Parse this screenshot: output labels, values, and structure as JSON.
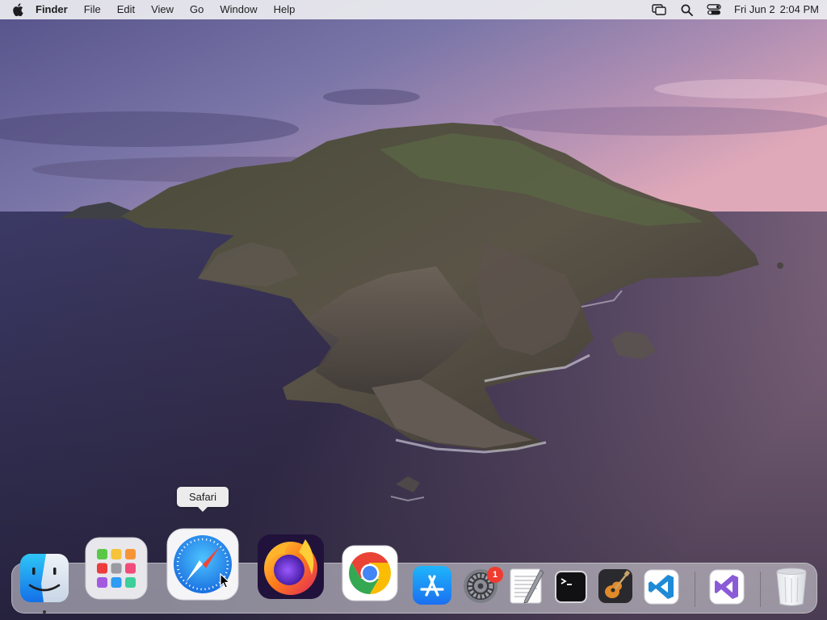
{
  "menubar": {
    "app_name": "Finder",
    "items": [
      "File",
      "Edit",
      "View",
      "Go",
      "Window",
      "Help"
    ],
    "status_icons": [
      "screen-mirroring-icon",
      "search-icon",
      "control-center-icon"
    ],
    "date": "Fri Jun 2",
    "time": "2:04 PM"
  },
  "tooltip": {
    "text": "Safari"
  },
  "dock": {
    "apps": [
      {
        "name": "Finder",
        "icon": "finder-icon"
      },
      {
        "name": "Launchpad",
        "icon": "launchpad-icon"
      },
      {
        "name": "Safari",
        "icon": "safari-icon"
      },
      {
        "name": "Firefox",
        "icon": "firefox-icon"
      },
      {
        "name": "Google Chrome",
        "icon": "chrome-icon"
      },
      {
        "name": "App Store",
        "icon": "app-store-icon"
      },
      {
        "name": "System Preferences",
        "icon": "gear-icon"
      },
      {
        "name": "TextEdit",
        "icon": "textedit-icon"
      },
      {
        "name": "Terminal",
        "icon": "terminal-icon"
      },
      {
        "name": "GarageBand",
        "icon": "guitar-icon"
      },
      {
        "name": "Visual Studio Code",
        "icon": "vscode-icon"
      },
      {
        "name": "Visual Studio",
        "icon": "visual-studio-icon"
      },
      {
        "name": "Trash",
        "icon": "trash-icon"
      }
    ],
    "system_prefs_badge": "1"
  },
  "colors": {
    "menubar": "#ececf0",
    "badge": "#f03b30",
    "safari_blue": "#1a8cf0"
  }
}
